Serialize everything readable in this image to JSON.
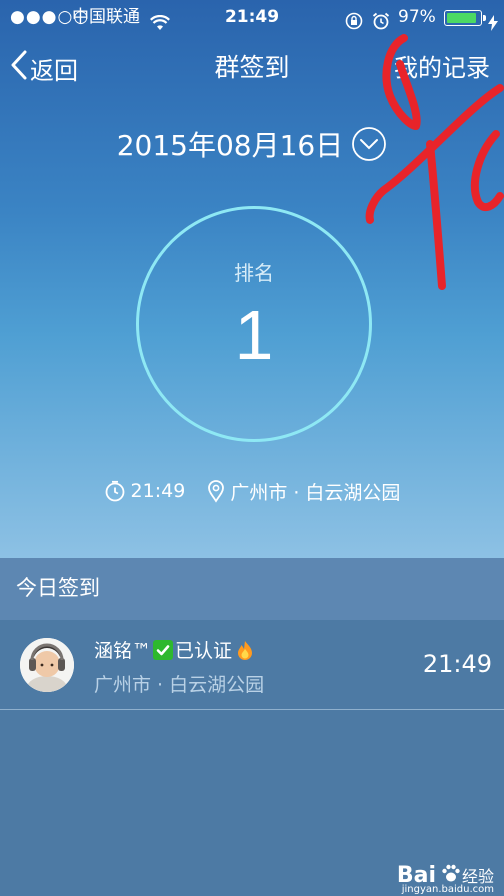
{
  "status_bar": {
    "signal": "●●●○○",
    "carrier": "中国联通",
    "time": "21:49",
    "battery": "97%",
    "battery_level": 0.97
  },
  "nav": {
    "back_label": "返回",
    "title": "群签到",
    "records_label": "我的记录"
  },
  "date": {
    "text": "2015年08月16日"
  },
  "rank": {
    "label": "排名",
    "value": "1"
  },
  "checkin": {
    "time": "21:49",
    "location": "广州市 · 白云湖公园"
  },
  "today": {
    "title": "今日签到",
    "items": [
      {
        "name": "涵铭™",
        "badge": "已认证",
        "location": "广州市 · 白云湖公园",
        "time": "21:49"
      }
    ]
  },
  "watermark": {
    "brand": "Bai",
    "text": "经验",
    "url": "jingyan.baidu.com"
  },
  "colors": {
    "accent_ring": "#8ee8f4",
    "scribble": "#e8242a",
    "battery": "#4cd964"
  }
}
